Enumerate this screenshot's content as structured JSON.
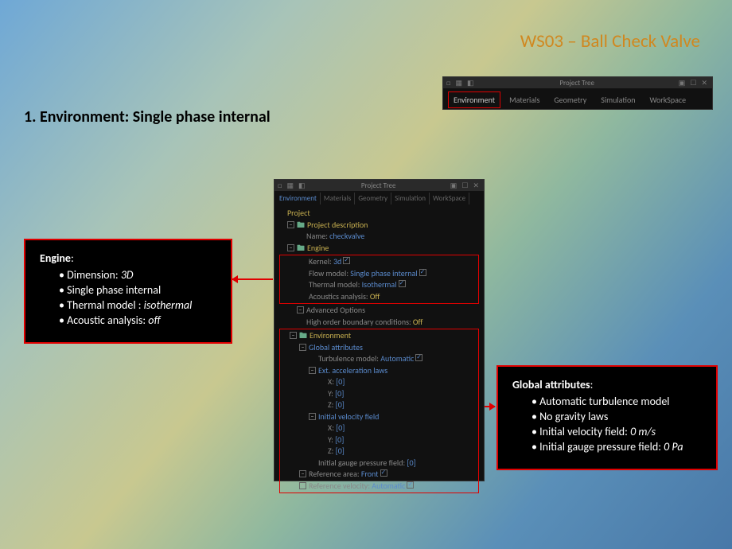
{
  "slide_title": "WS03 – Ball Check Valve",
  "heading": "1. Environment: Single phase internal",
  "callout_engine": {
    "title": "Engine",
    "items": [
      {
        "label": "Dimension: ",
        "value": "3D"
      },
      {
        "label": "Single phase internal",
        "value": ""
      },
      {
        "label": "Thermal model : ",
        "value": "isothermal"
      },
      {
        "label": "Acoustic analysis: ",
        "value": "off"
      }
    ]
  },
  "callout_global": {
    "title": "Global attributes",
    "items": [
      {
        "label": "Automatic turbulence model",
        "value": ""
      },
      {
        "label": "No gravity laws",
        "value": ""
      },
      {
        "label": "Initial velocity field: ",
        "value": "0 m/s"
      },
      {
        "label": "Initial gauge pressure field: ",
        "value": "0 Pa"
      }
    ]
  },
  "panel_title": "Project Tree",
  "titlebar_left": "□ ▦ ◧",
  "titlebar_right": "▣ ☐ ✕",
  "tabs": {
    "environment": "Environment",
    "materials": "Materials",
    "geometry": "Geometry",
    "simulation": "Simulation",
    "workspace": "WorkSpace"
  },
  "tree": {
    "project": "Project",
    "project_desc": "Project description",
    "name_label": "Name:",
    "name_value": "checkvalve",
    "engine": "Engine",
    "kernel_label": "Kernel:",
    "kernel_value": "3d",
    "flowmodel_label": "Flow model:",
    "flowmodel_value": "Single phase internal",
    "thermal_label": "Thermal model:",
    "thermal_value": "Isothermal",
    "acoustics_label": "Acoustics analysis:",
    "acoustics_value": "Off",
    "advanced": "Advanced Options",
    "hobc_label": "High order boundary conditions:",
    "hobc_value": "Off",
    "environment": "Environment",
    "global_attr": "Global attributes",
    "turb_label": "Turbulence model:",
    "turb_value": "Automatic",
    "ext_accel": "Ext. acceleration laws",
    "x_label": "X:",
    "x_value": "[0]",
    "y_label": "Y:",
    "y_value": "[0]",
    "z_label": "Z:",
    "z_value": "[0]",
    "ivf": "Initial velocity field",
    "igp_label": "Initial gauge pressure field:",
    "igp_value": "[0]",
    "refarea_label": "Reference area:",
    "refarea_value": "Front",
    "refvel_label": "Reference velocity:",
    "refvel_value": "Automatic"
  }
}
